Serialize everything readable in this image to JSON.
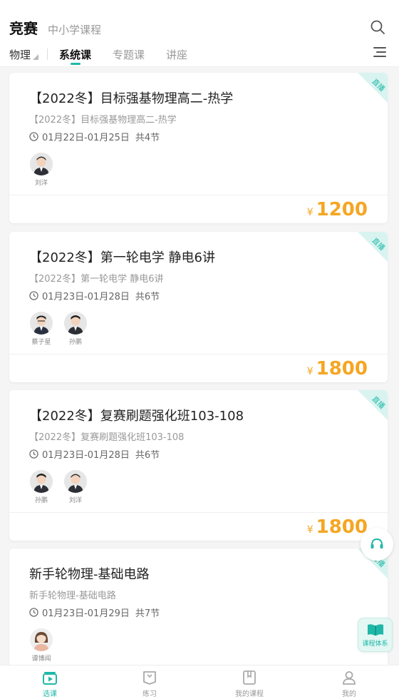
{
  "header": {
    "title": "竞赛",
    "subtitle": "中小学课程",
    "subject": "物理",
    "tabs": [
      "系统课",
      "专题课",
      "讲座"
    ]
  },
  "live_label": "直播",
  "currency": "¥",
  "courses": [
    {
      "title": "【2022冬】目标强基物理高二-热学",
      "subtitle": "【2022冬】目标强基物理高二-热学",
      "time": "01月22日-01月25日",
      "sessions": "共4节",
      "teachers": [
        "刘洋"
      ],
      "price": "1200"
    },
    {
      "title": "【2022冬】第一轮电学 静电6讲",
      "subtitle": "【2022冬】第一轮电学 静电6讲",
      "time": "01月23日-01月28日",
      "sessions": "共6节",
      "teachers": [
        "蔡子星",
        "孙鹏"
      ],
      "price": "1800"
    },
    {
      "title": "【2022冬】复赛刷题强化班103-108",
      "subtitle": "【2022冬】复赛刷题强化班103-108",
      "time": "01月23日-01月28日",
      "sessions": "共6节",
      "teachers": [
        "孙鹏",
        "刘洋"
      ],
      "price": "1800"
    },
    {
      "title": "新手轮物理-基础电路",
      "subtitle": "新手轮物理-基础电路",
      "time": "01月23日-01月29日",
      "sessions": "共7节",
      "teachers": [
        "谭博闻"
      ]
    }
  ],
  "float_button": "课程体系",
  "bottom_nav": [
    "选课",
    "练习",
    "我的课程",
    "我的"
  ],
  "colors": {
    "accent": "#1fb8a8",
    "price": "#f5a623"
  }
}
